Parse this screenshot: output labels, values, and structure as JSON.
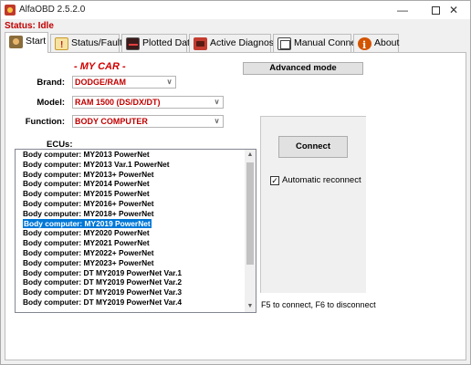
{
  "window": {
    "title": "AlfaOBD 2.5.2.0",
    "controls": {
      "minimize": "—",
      "close": "✕"
    }
  },
  "status": "Status: Idle",
  "tabs": [
    {
      "label": "Start",
      "icon": "car-icon",
      "active": true
    },
    {
      "label": "Status/Faults",
      "icon": "warning-icon",
      "active": false
    },
    {
      "label": "Plotted Data",
      "icon": "oscilloscope-icon",
      "active": false
    },
    {
      "label": "Active Diagnostic",
      "icon": "ecu-icon",
      "active": false
    },
    {
      "label": "Manual Connect",
      "icon": "connector-icon",
      "active": false
    },
    {
      "label": "About",
      "icon": "info-icon",
      "active": false
    }
  ],
  "main": {
    "heading": "- MY CAR -",
    "advanced_button": "Advanced mode",
    "brand": {
      "label": "Brand:",
      "value": "DODGE/RAM"
    },
    "model": {
      "label": "Model:",
      "value": "RAM 1500 (DS/DX/DT)"
    },
    "function": {
      "label": "Function:",
      "value": "BODY COMPUTER"
    },
    "ecus_label": "ECUs:",
    "ecus": [
      "Body computer: MY2013 PowerNet",
      "Body computer: MY2013 Var.1 PowerNet",
      "Body computer: MY2013+ PowerNet",
      "Body computer: MY2014 PowerNet",
      "Body computer: MY2015 PowerNet",
      "Body computer: MY2016+ PowerNet",
      "Body computer: MY2018+ PowerNet",
      "Body computer: MY2019 PowerNet",
      "Body computer: MY2020 PowerNet",
      "Body computer: MY2021 PowerNet",
      "Body computer: MY2022+ PowerNet",
      "Body computer: MY2023+ PowerNet",
      "Body computer: DT MY2019 PowerNet Var.1",
      "Body computer: DT MY2019 PowerNet Var.2",
      "Body computer: DT MY2019 PowerNet Var.3",
      "Body computer: DT MY2019 PowerNet Var.4"
    ],
    "selected_ecu_index": 7,
    "connect_button": "Connect",
    "auto_reconnect": {
      "label": "Automatic reconnect",
      "checked": true
    },
    "hint": "F5 to connect, F6 to disconnect"
  },
  "colors": {
    "status_red": "#c00000",
    "selection_blue": "#0078d7"
  }
}
